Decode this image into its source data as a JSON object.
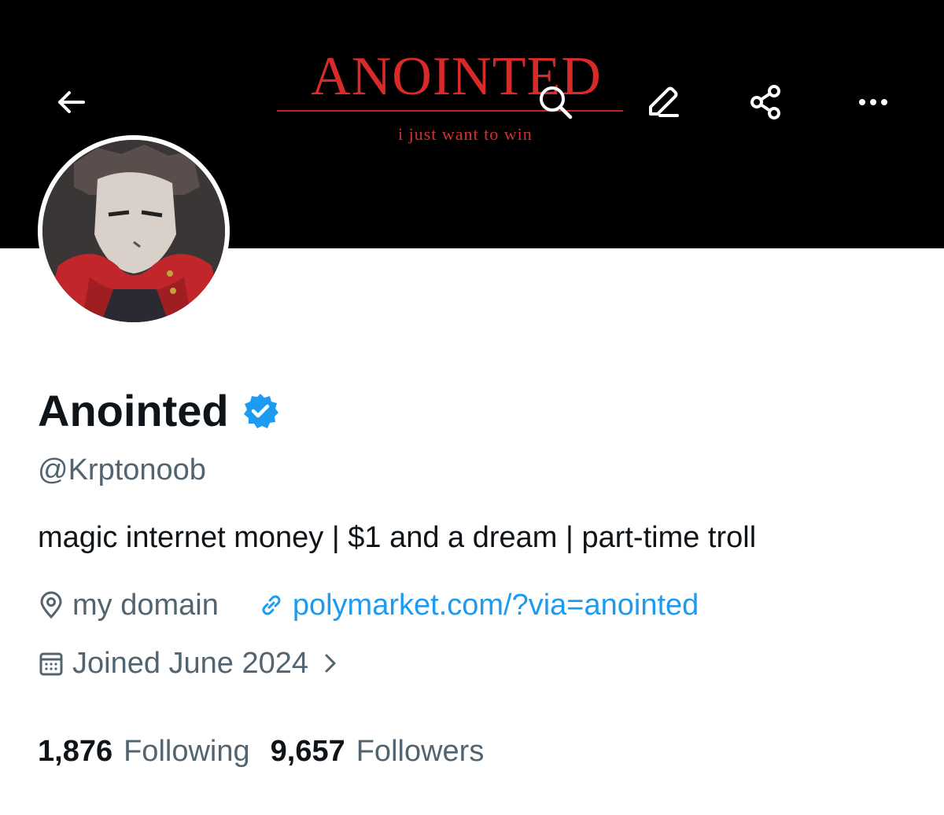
{
  "banner": {
    "title": "ANOINTED",
    "subtitle": "i just want to win",
    "title_color": "#d92a2a",
    "background": "#000000"
  },
  "toolbar": {
    "back_icon": "arrow-left-icon",
    "search_icon": "search-icon",
    "edit_icon": "pencil-icon",
    "share_icon": "share-icon",
    "more_icon": "more-horizontal-icon"
  },
  "profile": {
    "name": "Anointed",
    "verified_icon": "verified-badge-icon",
    "verified_color": "#1d9bf0",
    "handle": "@Krptonoob",
    "bio": "magic internet money | $1 and a dream | part-time troll",
    "location": "my domain",
    "website": "polymarket.com/?via=anointed",
    "joined": "Joined June 2024"
  },
  "stats": {
    "following_count": "1,876",
    "following_label": "Following",
    "followers_count": "9,657",
    "followers_label": "Followers"
  }
}
